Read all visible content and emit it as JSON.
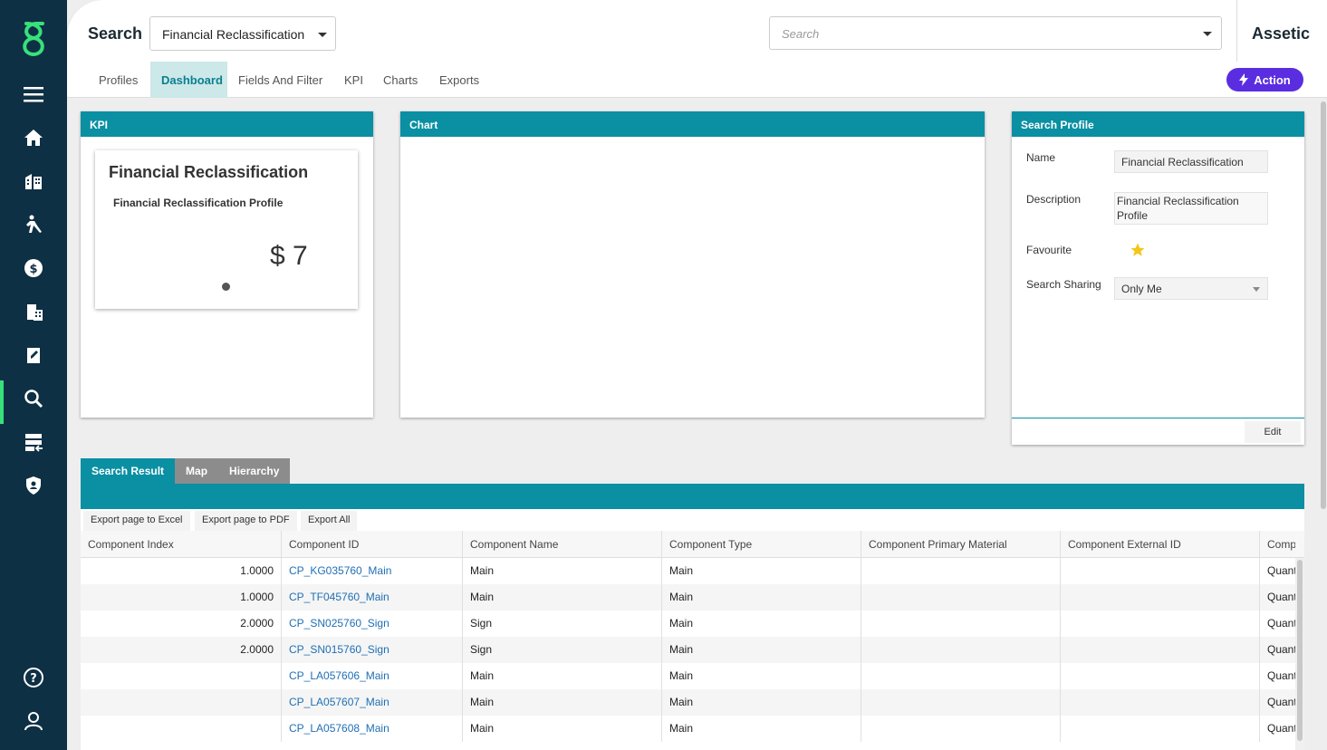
{
  "header": {
    "title": "Search",
    "profile_select": "Financial Reclassification",
    "search_placeholder": "Search",
    "brand": "Assetic"
  },
  "tabs": [
    "Profiles",
    "Dashboard",
    "Fields And Filter",
    "KPI",
    "Charts",
    "Exports"
  ],
  "active_tab": "Dashboard",
  "action_label": "Action",
  "kpi_panel": {
    "title": "KPI",
    "card_title": "Financial Reclassification",
    "card_subtitle": "Financial Reclassification Profile",
    "value": "$ 7"
  },
  "chart_panel": {
    "title": "Chart"
  },
  "search_profile": {
    "title": "Search Profile",
    "name_label": "Name",
    "name_value": "Financial Reclassification",
    "description_label": "Description",
    "description_value": "Financial Reclassification Profile",
    "favourite_label": "Favourite",
    "favourite": true,
    "sharing_label": "Search Sharing",
    "sharing_value": "Only Me",
    "edit_label": "Edit"
  },
  "result_tabs": [
    "Search Result",
    "Map",
    "Hierarchy"
  ],
  "export_buttons": [
    "Export page to Excel",
    "Export page to PDF",
    "Export All"
  ],
  "grid": {
    "columns": [
      "Component Index",
      "Component ID",
      "Component Name",
      "Component Type",
      "Component Primary Material",
      "Component External ID",
      "Comp"
    ],
    "rows": [
      [
        "1.0000",
        "CP_KG035760_Main",
        "Main",
        "Main",
        "",
        "",
        "Quant"
      ],
      [
        "1.0000",
        "CP_TF045760_Main",
        "Main",
        "Main",
        "",
        "",
        "Quant"
      ],
      [
        "2.0000",
        "CP_SN025760_Sign",
        "Sign",
        "Main",
        "",
        "",
        "Quant"
      ],
      [
        "2.0000",
        "CP_SN015760_Sign",
        "Sign",
        "Main",
        "",
        "",
        "Quant"
      ],
      [
        "",
        "CP_LA057606_Main",
        "Main",
        "Main",
        "",
        "",
        "Quant"
      ],
      [
        "",
        "CP_LA057607_Main",
        "Main",
        "Main",
        "",
        "",
        "Quant"
      ],
      [
        "",
        "CP_LA057608_Main",
        "Main",
        "Main",
        "",
        "",
        "Quant"
      ]
    ]
  },
  "colors": {
    "sidebar": "#0e3044",
    "accent": "#0a8fa3",
    "action": "#5b2de0",
    "logo": "#38e07b"
  }
}
